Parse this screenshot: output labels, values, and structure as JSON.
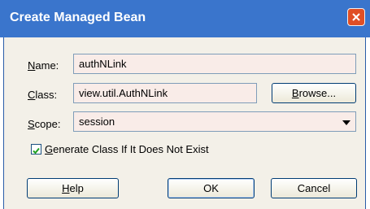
{
  "window": {
    "title": "Create Managed Bean"
  },
  "form": {
    "name_label_mn": "N",
    "name_label_rest": "ame:",
    "name_value": "authNLink",
    "class_label_mn": "C",
    "class_label_rest": "lass:",
    "class_value": "view.util.AuthNLink",
    "browse_mn": "B",
    "browse_rest": "rowse...",
    "scope_label_mn": "S",
    "scope_label_rest": "cope:",
    "scope_value": "session",
    "generate_mn": "G",
    "generate_rest": "enerate Class If It Does Not Exist"
  },
  "buttons": {
    "help_mn": "H",
    "help_rest": "elp",
    "ok": "OK",
    "cancel": "Cancel"
  },
  "colors": {
    "titlebar": "#3a75cc",
    "field_bg": "#f9ece8",
    "panel_bg": "#f3f0e8",
    "close": "#e04f25"
  }
}
